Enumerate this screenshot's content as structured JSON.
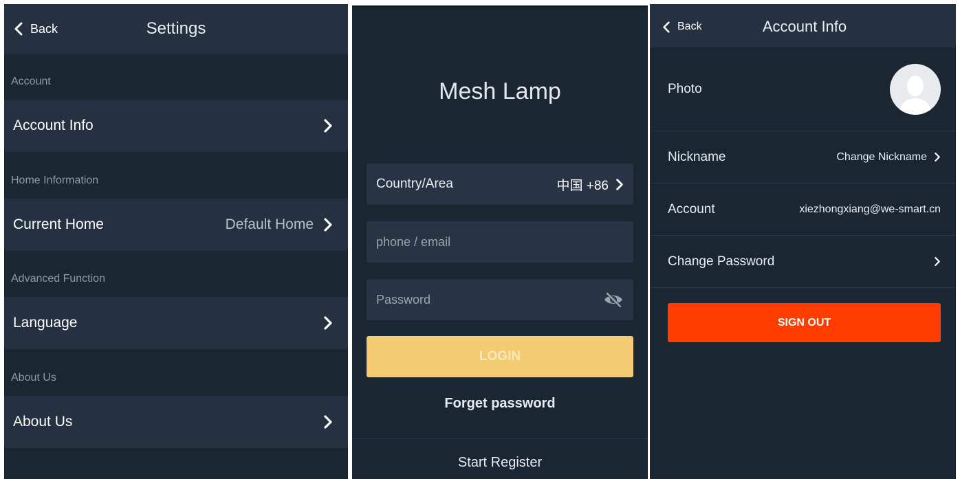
{
  "settings": {
    "back_label": "Back",
    "title": "Settings",
    "sections": [
      {
        "header": "Account",
        "item": "Account Info",
        "value": ""
      },
      {
        "header": "Home Information",
        "item": "Current Home",
        "value": "Default Home"
      },
      {
        "header": "Advanced Function",
        "item": "Language",
        "value": ""
      },
      {
        "header": "About Us",
        "item": "About Us",
        "value": ""
      }
    ]
  },
  "login": {
    "app_title": "Mesh Lamp",
    "country_label": "Country/Area",
    "country_value": "中国  +86",
    "phone_placeholder": "phone / email",
    "password_placeholder": "Password",
    "login_label": "LOGIN",
    "forget_label": "Forget password",
    "register_label": "Start Register"
  },
  "account": {
    "back_label": "Back",
    "title": "Account Info",
    "photo_label": "Photo",
    "nickname_label": "Nickname",
    "nickname_action": "Change Nickname",
    "account_label": "Account",
    "account_value": "xiezhongxiang@we-smart.cn",
    "change_password_label": "Change Password",
    "signout_label": "SIGN OUT"
  },
  "colors": {
    "background": "#1b2633",
    "row": "#253140",
    "login_button": "#f3cb73",
    "signout_button": "#ff3d00"
  }
}
